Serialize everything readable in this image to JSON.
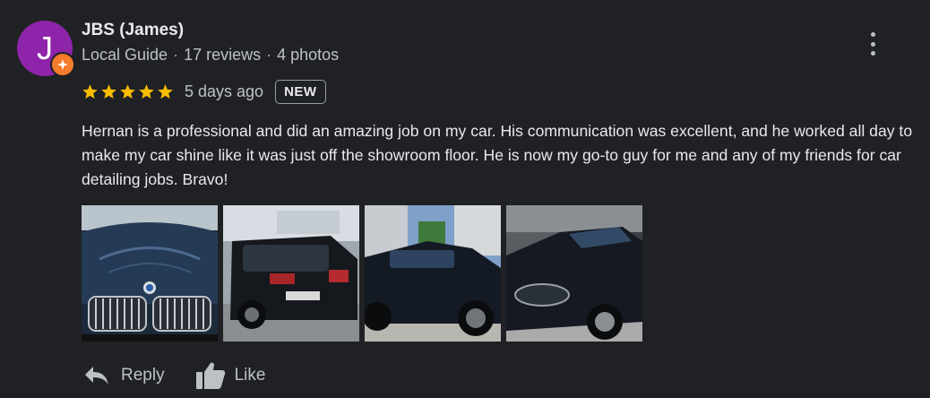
{
  "reviewer": {
    "avatar_letter": "J",
    "avatar_color": "#8e24aa",
    "name": "JBS (James)",
    "badge_icon": "local-guide-star-icon",
    "role": "Local Guide",
    "reviews": "17 reviews",
    "photos": "4 photos"
  },
  "review": {
    "rating": 5,
    "max_rating": 5,
    "star_color": "#fbbc04",
    "time_ago": "5 days ago",
    "new_badge": "NEW",
    "text": "Hernan is a professional and did an amazing job on my car. His communication was excellent, and he worked all day to make my car shine like it was just off the showroom floor. He is now my go-to guy for me and any of my friends for car detailing jobs. Bravo!"
  },
  "photos": [
    {
      "subject": "black BMW front grille close-up"
    },
    {
      "subject": "black SUV rear view in driveway"
    },
    {
      "subject": "black SUV side view on street"
    },
    {
      "subject": "black SUV front quarter in garage"
    }
  ],
  "actions": {
    "reply_label": "Reply",
    "like_label": "Like"
  },
  "icons": {
    "menu": "more-vert-icon",
    "reply": "reply-arrow-icon",
    "like": "thumbs-up-icon"
  }
}
